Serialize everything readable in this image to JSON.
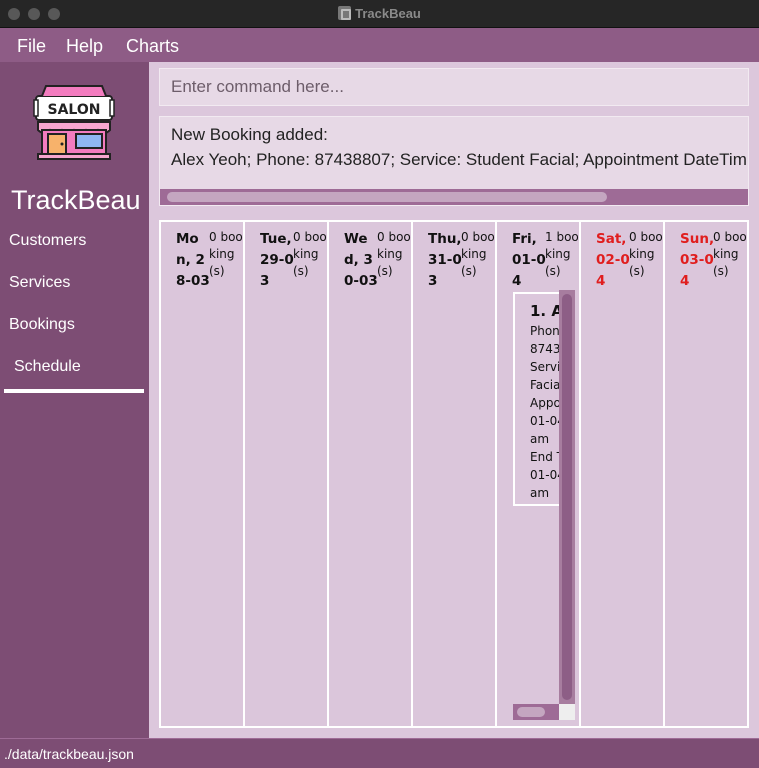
{
  "window": {
    "title": "TrackBeau"
  },
  "menu": {
    "items": [
      "File",
      "Help",
      "Charts"
    ]
  },
  "sidebar": {
    "logo_text": "SALON",
    "app_name": "TrackBeau",
    "items": [
      {
        "label": "Customers"
      },
      {
        "label": "Services"
      },
      {
        "label": "Bookings"
      },
      {
        "label": "Schedule",
        "selected": true
      }
    ]
  },
  "command": {
    "placeholder": "Enter command here...",
    "value": ""
  },
  "result": {
    "line1": "New Booking added:",
    "line2": "Alex Yeoh; Phone: 87438807; Service: Student Facial; Appointment DateTim"
  },
  "schedule": {
    "days": [
      {
        "name": "Mon, 28-03",
        "count": "0 booking(s)",
        "weekend": false
      },
      {
        "name": "Tue, 29-03",
        "count": "0 booking(s)",
        "weekend": false
      },
      {
        "name": "Wed, 30-03",
        "count": "0 booking(s)",
        "weekend": false
      },
      {
        "name": "Thu, 31-03",
        "count": "0 booking(s)",
        "weekend": false
      },
      {
        "name": "Fri, 01-04",
        "count": "1 booking(s)",
        "weekend": false
      },
      {
        "name": "Sat, 02-04",
        "count": "0 booking(s)",
        "weekend": true
      },
      {
        "name": "Sun, 03-04",
        "count": "0 booking(s)",
        "weekend": true
      }
    ],
    "booking": {
      "title": "1. A",
      "lines": [
        "Phon",
        "8743",
        "Servi",
        "Facia",
        "Appo",
        "01-04",
        "am",
        "End T",
        "01-04",
        "am"
      ]
    }
  },
  "status": {
    "path": "./data/trackbeau.json"
  },
  "colors": {
    "accent": "#7d4d74",
    "menubar": "#8e5c86",
    "panel": "#dcc7dc",
    "weekend": "#e01e1e"
  }
}
